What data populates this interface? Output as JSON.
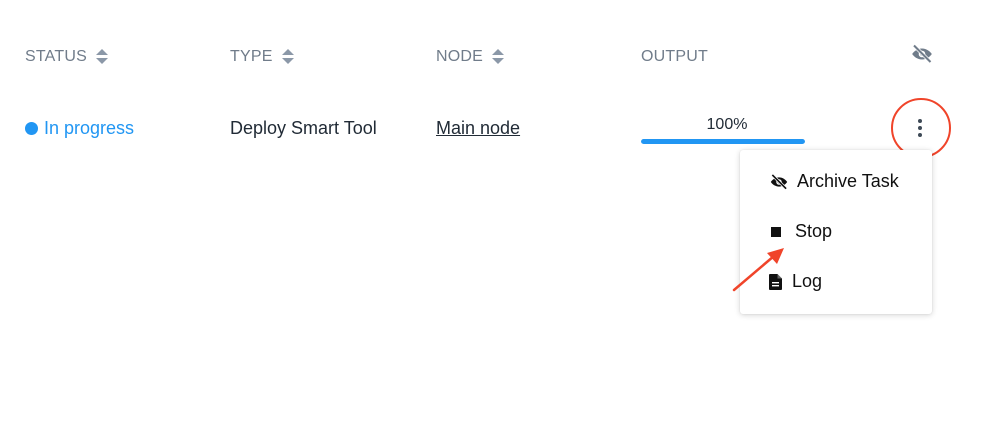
{
  "table": {
    "headers": {
      "status": "STATUS",
      "type": "TYPE",
      "node": "NODE",
      "output": "OUTPUT"
    },
    "row": {
      "status": "In progress",
      "type": "Deploy Smart Tool",
      "node": "Main node",
      "output_label": "100%",
      "progress": 1.0
    }
  },
  "menu": {
    "archive_label": "Archive Task",
    "stop_label": "Stop",
    "log_label": "Log"
  },
  "icons": {
    "sort": "sort-icon",
    "hide_columns": "eye-off-icon",
    "row_actions": "more-vertical-icon",
    "archive": "eye-off-icon",
    "stop": "stop-icon",
    "log": "file-icon"
  },
  "colors": {
    "accent": "#2196f3",
    "annotation": "#f0442a",
    "header_text": "#707c8a"
  }
}
